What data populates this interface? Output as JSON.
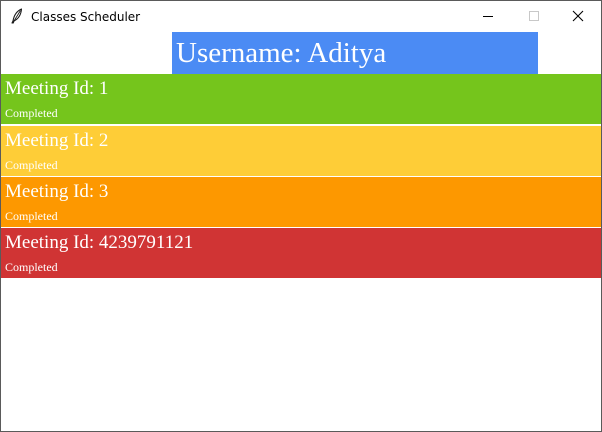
{
  "window": {
    "title": "Classes Scheduler",
    "icon": "feather-icon"
  },
  "header": {
    "username_label": "Username: Aditya",
    "background_color": "#4b8bf4"
  },
  "meetings": [
    {
      "title": "Meeting Id: 1",
      "status": "Completed",
      "color": "#75c51c"
    },
    {
      "title": "Meeting Id: 2",
      "status": "Completed",
      "color": "#fecd37"
    },
    {
      "title": "Meeting Id: 3",
      "status": "Completed",
      "color": "#fd9800"
    },
    {
      "title": "Meeting Id: 4239791121",
      "status": "Completed",
      "color": "#d03434"
    }
  ]
}
